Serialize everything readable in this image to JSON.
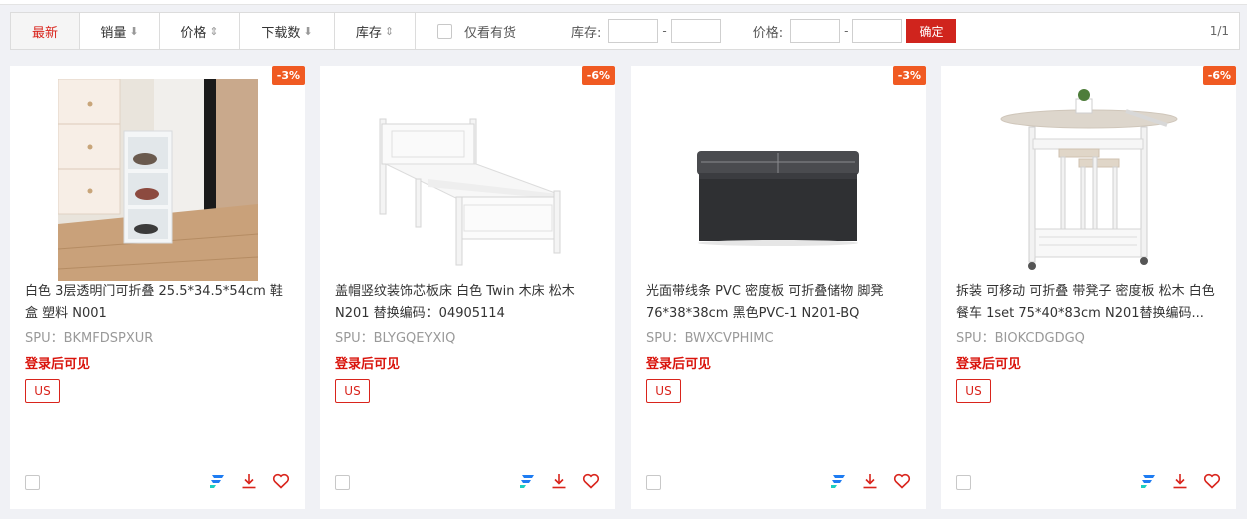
{
  "toolbar": {
    "sorts": [
      {
        "label": "最新",
        "arrow": "",
        "active": true
      },
      {
        "label": "销量",
        "arrow": "⬇",
        "active": false
      },
      {
        "label": "价格",
        "arrow": "⇕",
        "active": false
      },
      {
        "label": "下载数",
        "arrow": "⬇",
        "active": false
      },
      {
        "label": "库存",
        "arrow": "⇕",
        "active": false
      }
    ],
    "in_stock_only": "仅看有货",
    "stock_label": "库存:",
    "price_label": "价格:",
    "stock_min": "",
    "stock_max": "",
    "price_min": "",
    "price_max": "",
    "dash": "-",
    "confirm": "确定",
    "pager": "1/1"
  },
  "products": [
    {
      "discount": "-3%",
      "title": "白色 3层透明门可折叠 25.5*34.5*54cm 鞋盒 塑料 N001",
      "spu": "SPU：BKMFDSPXUR",
      "price_tip": "登录后可见",
      "region": "US",
      "image": "shoe-cabinet"
    },
    {
      "discount": "-6%",
      "title": "盖帽竖纹装饰芯板床 白色 Twin 木床 松木 N201 替换编码：04905114",
      "spu": "SPU：BLYGQEYXIQ",
      "price_tip": "登录后可见",
      "region": "US",
      "image": "white-bed"
    },
    {
      "discount": "-3%",
      "title": "光面带线条 PVC 密度板 可折叠储物 脚凳 76*38*38cm 黑色PVC-1 N201-BQ",
      "spu": "SPU：BWXCVPHIMC",
      "price_tip": "登录后可见",
      "region": "US",
      "image": "storage-ottoman"
    },
    {
      "discount": "-6%",
      "title": "拆装 可移动 可折叠 带凳子 密度板 松木 白色 餐车 1set 75*40*83cm N201替换编码...",
      "spu": "SPU：BIOKCDGDGQ",
      "price_tip": "登录后可见",
      "region": "US",
      "image": "kitchen-cart"
    }
  ],
  "colors": {
    "accent": "#d9241c",
    "badge": "#f05a22",
    "brand_icon": "#1e7cf2"
  }
}
